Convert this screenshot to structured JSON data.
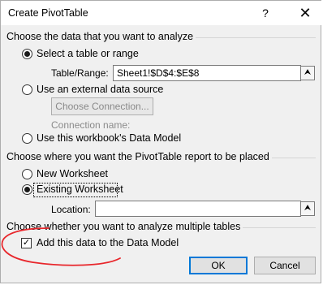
{
  "dialog": {
    "title": "Create PivotTable",
    "help_glyph": "?",
    "close_glyph": "✕"
  },
  "section_data": {
    "heading": "Choose the data that you want to analyze",
    "select_table_label": "Select a table or range",
    "table_range_label": "Table/Range:",
    "table_range_value": "Sheet1!$D$4:$E$8",
    "collapse_glyph": "⮝",
    "external_source_label": "Use an external data source",
    "choose_connection_label": "Choose Connection...",
    "connection_name_label": "Connection name:",
    "data_model_label": "Use this workbook's Data Model"
  },
  "section_place": {
    "heading": "Choose where you want the PivotTable report to be placed",
    "new_worksheet_label": "New Worksheet",
    "existing_worksheet_label": "Existing Worksheet",
    "location_label": "Location:",
    "location_value": ""
  },
  "section_multi": {
    "heading": "Choose whether you want to analyze multiple tables",
    "add_to_model_label": "Add this data to the Data Model",
    "check_glyph": "✓"
  },
  "buttons": {
    "ok_label": "OK",
    "cancel_label": "Cancel"
  },
  "colors": {
    "annotation": "#e8262b",
    "default_button_border": "#0078d7"
  },
  "state": {
    "select_table_selected": true,
    "existing_worksheet_selected": true,
    "add_to_model_checked": true
  }
}
